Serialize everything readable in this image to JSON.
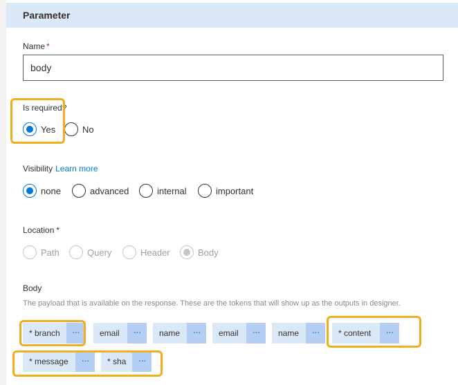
{
  "header": {
    "title": "Parameter"
  },
  "name_field": {
    "label": "Name",
    "required_mark": "*",
    "value": "body"
  },
  "is_required": {
    "label": "Is required?",
    "options": [
      {
        "label": "Yes",
        "checked": true
      },
      {
        "label": "No",
        "checked": false
      }
    ]
  },
  "visibility": {
    "label": "Visibility",
    "link": "Learn more",
    "options": [
      {
        "label": "none",
        "checked": true
      },
      {
        "label": "advanced",
        "checked": false
      },
      {
        "label": "internal",
        "checked": false
      },
      {
        "label": "important",
        "checked": false
      }
    ]
  },
  "location": {
    "label": "Location",
    "required_mark": "*",
    "options": [
      {
        "label": "Path",
        "checked": false
      },
      {
        "label": "Query",
        "checked": false
      },
      {
        "label": "Header",
        "checked": false
      },
      {
        "label": "Body",
        "checked": true
      }
    ]
  },
  "body_section": {
    "label": "Body",
    "description": "The payload that is available on the response. These are the tokens that will show up as the outputs in designer.",
    "more_glyph": "···",
    "tokens": [
      {
        "label": "* branch"
      },
      {
        "label": "email"
      },
      {
        "label": "name"
      },
      {
        "label": "email"
      },
      {
        "label": "name"
      },
      {
        "label": "* content"
      },
      {
        "label": "* message"
      },
      {
        "label": "* sha"
      }
    ]
  },
  "colors": {
    "accent": "#0078d4",
    "highlight": "#f0ad1e",
    "header_bg": "#dbe8f8",
    "token_bg": "#dbe8f8",
    "token_more_bg": "#b4cff3",
    "required": "#a4262c"
  }
}
